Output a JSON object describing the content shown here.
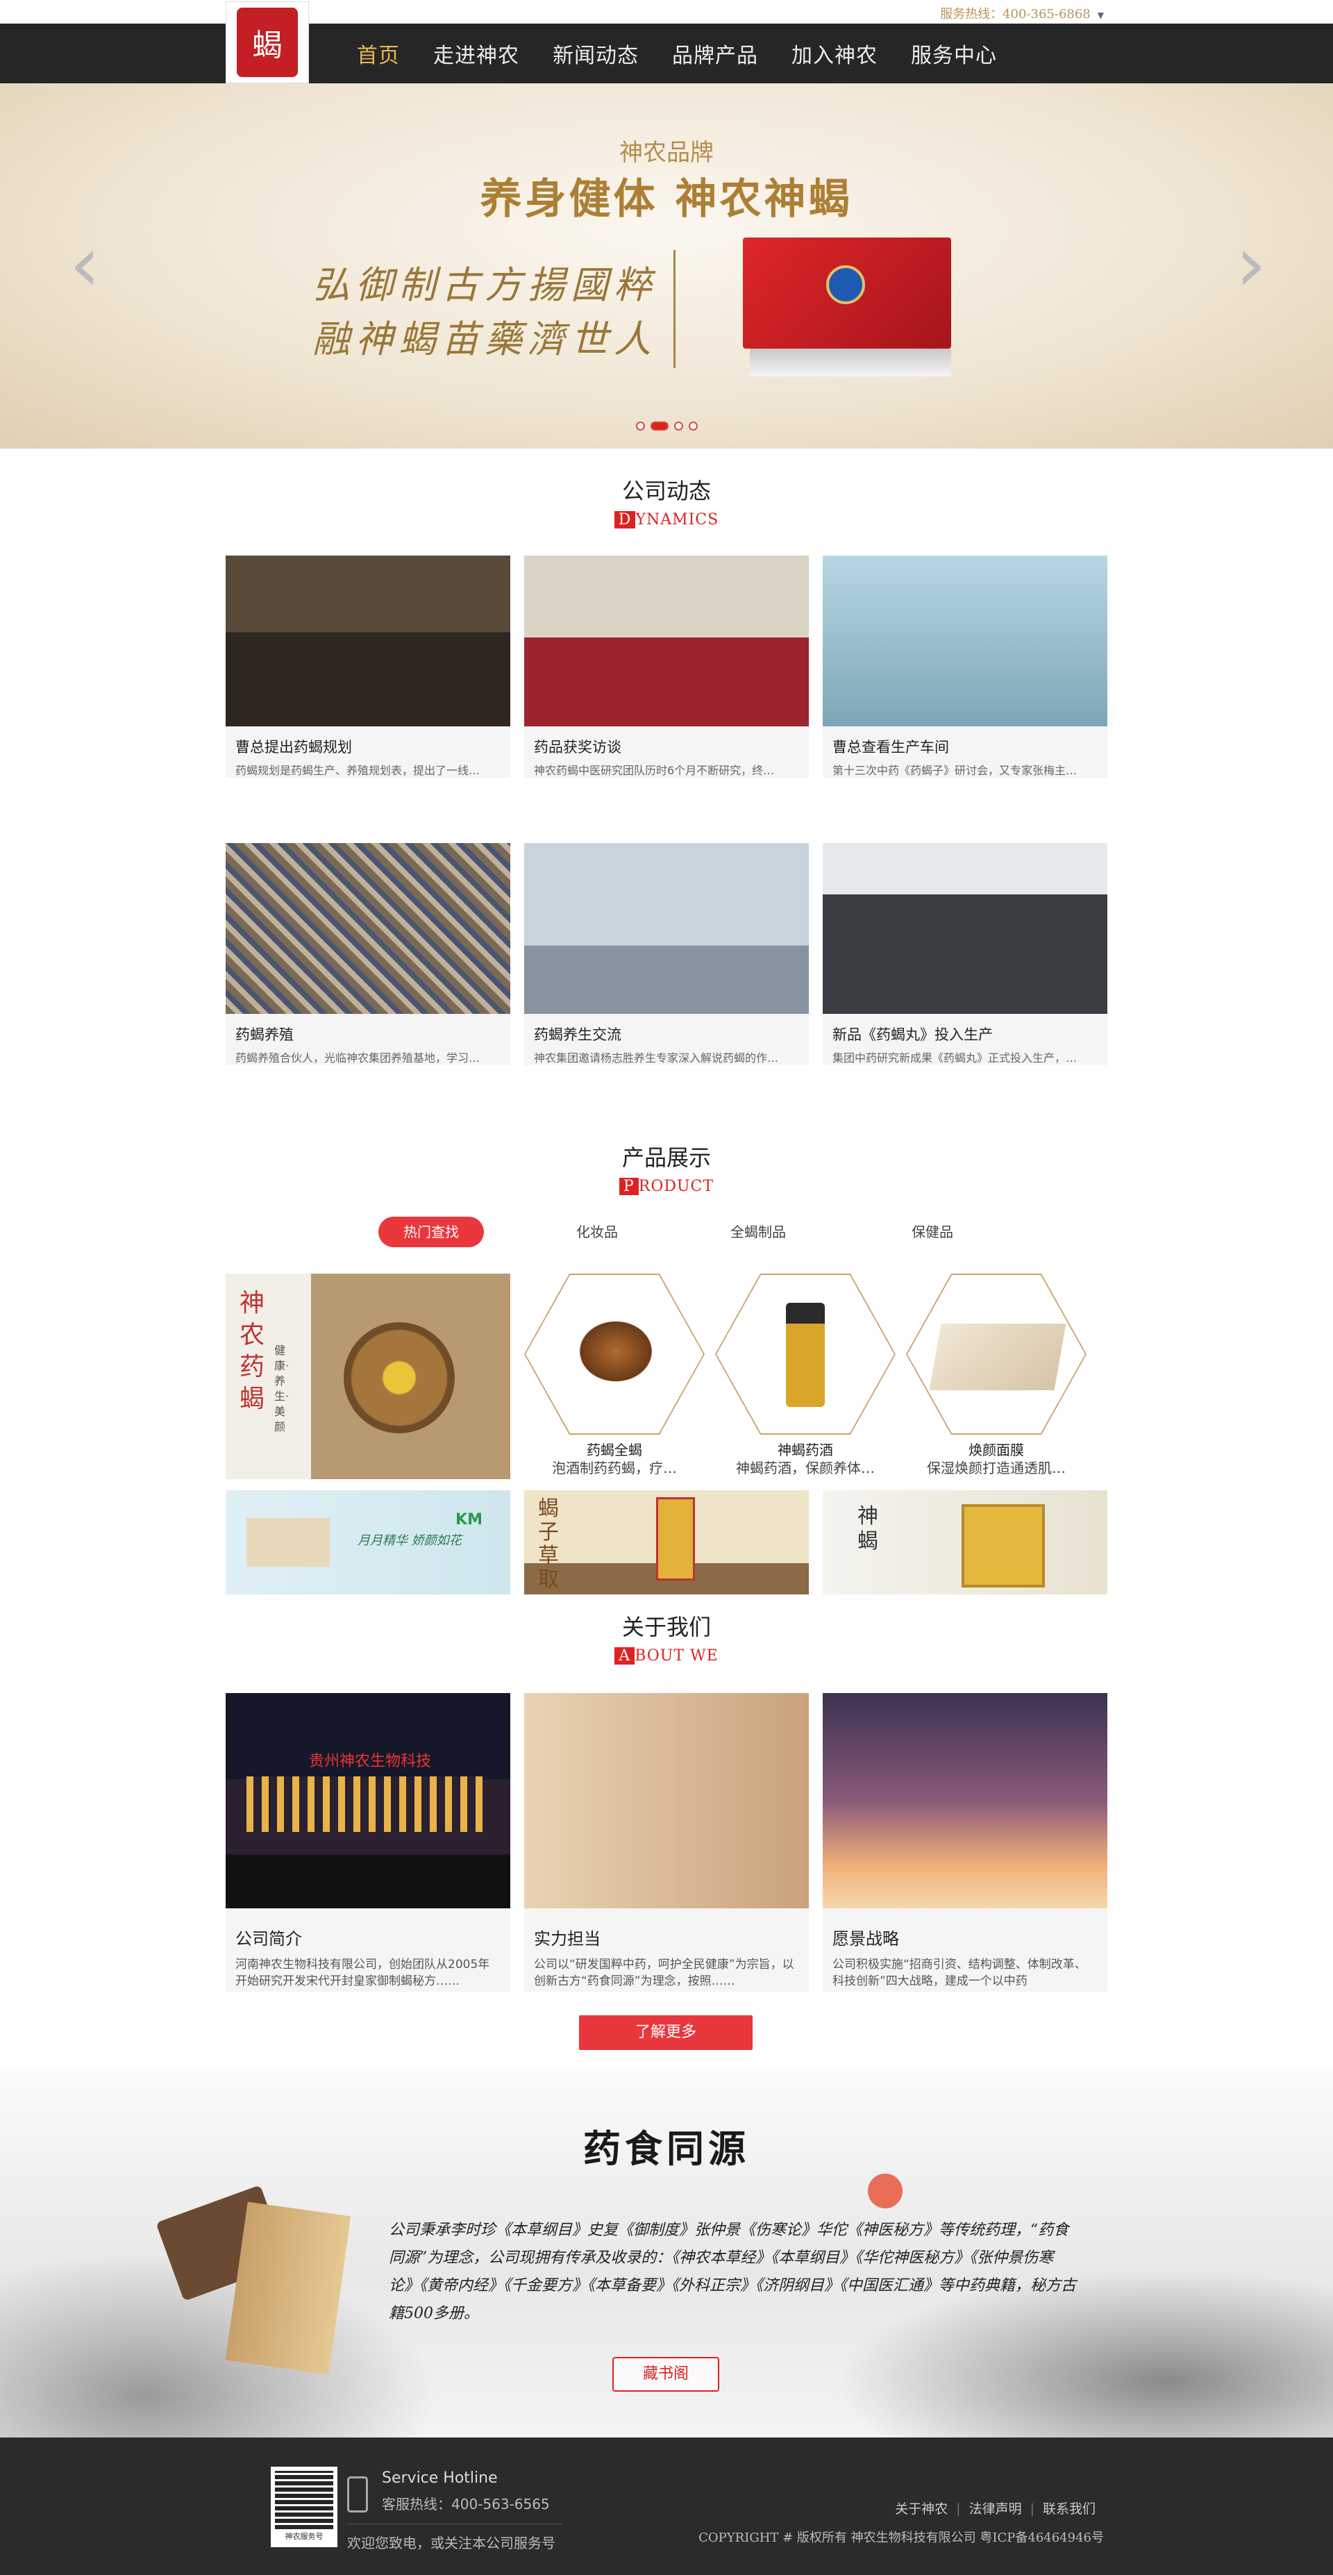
{
  "topbar": {
    "hotline": "服务热线：400-365-6868"
  },
  "nav": {
    "items": [
      "首页",
      "走进神农",
      "新闻动态",
      "品牌产品",
      "加入神农",
      "服务中心"
    ]
  },
  "banner": {
    "subtitle": "神农品牌",
    "title": "养身健体  神农神蝎",
    "calli_1": "弘御制古方揚國粹",
    "calli_2": "融神蝎苗藥濟世人"
  },
  "news": {
    "title": "公司动态",
    "en_first": "D",
    "en_rest": "YNAMICS",
    "items": [
      {
        "title": "曹总提出药蝎规划",
        "desc": "药蝎规划是药蝎生产、养殖规划表，提出了一线…"
      },
      {
        "title": "药品获奖访谈",
        "desc": "神农药蝎中医研究团队历时6个月不断研究，终…"
      },
      {
        "title": "曹总查看生产车间",
        "desc": "第十三次中药《药蝎子》研讨会，又专家张梅主…"
      },
      {
        "title": "药蝎养殖",
        "desc": "药蝎养殖合伙人，光临神农集团养殖基地，学习…"
      },
      {
        "title": "药蝎养生交流",
        "desc": "神农集团邀请杨志胜养生专家深入解说药蝎的作…"
      },
      {
        "title": "新品《药蝎丸》投入生产",
        "desc": "集团中药研究新成果《药蝎丸》正式投入生产，…"
      }
    ]
  },
  "products": {
    "title": "产品展示",
    "en_first": "P",
    "en_rest": "RODUCT",
    "tabs": [
      "热门查找",
      "化妆品",
      "全蝎制品",
      "保健品"
    ],
    "banner_text": [
      "神",
      "农",
      "药",
      "蝎"
    ],
    "banner_side": "健康·养生·美颜",
    "items": [
      {
        "name": "药蝎全蝎",
        "desc": "泡酒制药药蝎，疗…"
      },
      {
        "name": "神蝎药酒",
        "desc": "神蝎药酒，保颜养体…"
      },
      {
        "name": "焕颜面膜",
        "desc": "保湿焕颜打造通透肌…"
      }
    ],
    "mini_banner_1": "月月精华 娇颜如花",
    "mini_banner_1_logo": "KM",
    "mini_banner_2": "蝎子草取",
    "mini_banner_3": "神蝎"
  },
  "about": {
    "title": "关于我们",
    "en_first": "A",
    "en_rest": "BOUT WE",
    "items": [
      {
        "title": "公司简介",
        "desc": "河南神农生物科技有限公司，创始团队从2005年开始研究开发宋代开封皇家御制蝎秘方……"
      },
      {
        "title": "实力担当",
        "desc": "公司以“研发国粹中药，呵护全民健康”为宗旨，以创新古方“药食同源”为理念，按照……"
      },
      {
        "title": "愿景战略",
        "desc": "公司积极实施“招商引资、结构调整、体制改革、科技创新”四大战略，建成一个以中药"
      }
    ],
    "more_label": "了解更多",
    "sign_text": "贵州神农生物科技"
  },
  "ink": {
    "title": "药食同源",
    "text": "公司秉承李时珍《本草纲目》史复《御制度》张仲景《伤寒论》华佗《神医秘方》等传统药理，“药食同源”为理念，公司现拥有传承及收录的：《神农本草经》《本草纲目》《华佗神医秘方》《张仲景伤寒论》《黄帝内经》《千金要方》《本草备要》《外科正宗》《济阴纲目》《中国医汇通》等中药典籍，秘方古籍500多册。",
    "button": "藏书阁"
  },
  "footer": {
    "qr_caption": "神农服务号",
    "service_en": "Service Hotline",
    "service_phone": "客服热线：400-563-6565",
    "welcome": "欢迎您致电，或关注本公司服务号",
    "links": [
      "关于神农",
      "法律声明",
      "联系我们"
    ],
    "copyright": "COPYRIGHT # 版权所有 神农生物科技有限公司 粤ICP备46464946号"
  }
}
